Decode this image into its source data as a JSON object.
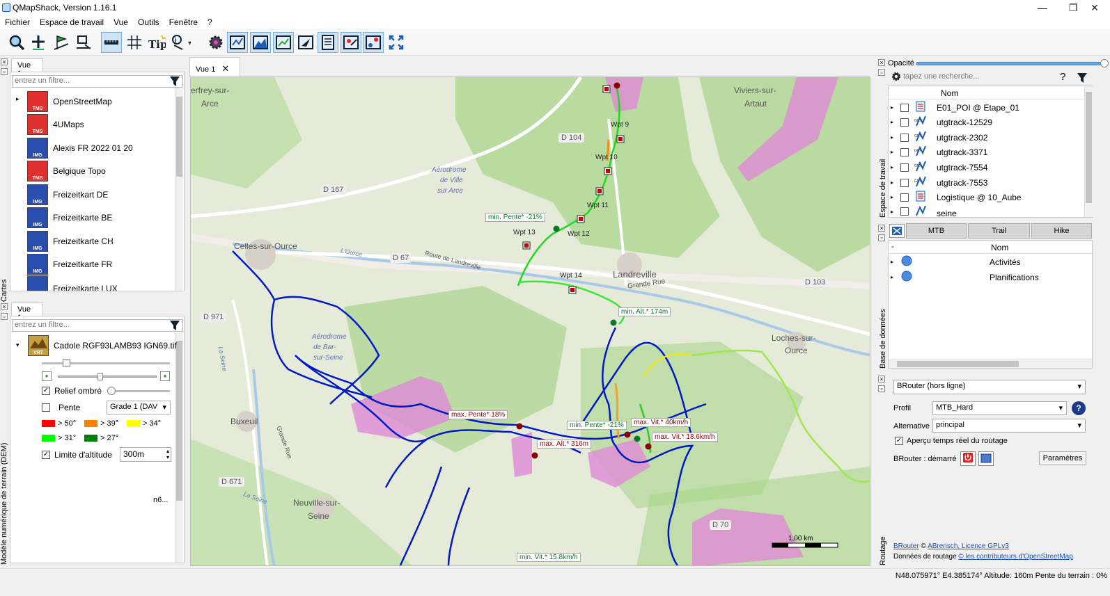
{
  "window": {
    "title": "QMapShack, Version 1.16.1"
  },
  "menu": [
    "Fichier",
    "Espace de travail",
    "Vue",
    "Outils",
    "Fenêtre",
    "?"
  ],
  "maps_panel": {
    "side_label": "Cartes",
    "tab": "Vue 1",
    "filter_placeholder": "entrez un filtre...",
    "items": [
      {
        "name": "OpenStreetMap",
        "type": "TMS"
      },
      {
        "name": "4UMaps",
        "type": "TMS"
      },
      {
        "name": "Alexis FR 2022 01 20",
        "type": "IMG"
      },
      {
        "name": "Belgique Topo",
        "type": "TMS"
      },
      {
        "name": "Freizeitkart DE",
        "type": "IMG"
      },
      {
        "name": "Freizeitkarte BE",
        "type": "IMG"
      },
      {
        "name": "Freizeitkarte CH",
        "type": "IMG"
      },
      {
        "name": "Freizeitkarte FR",
        "type": "IMG"
      },
      {
        "name": "Freizeitkarte LUX",
        "type": "IMG"
      }
    ]
  },
  "dem_panel": {
    "side_label": "Modèle numérique de terrain (DEM)",
    "tab": "Vue 1",
    "filter_placeholder": "entrez un filtre...",
    "item": {
      "name": "Cadole RGF93LAMB93 IGN69.tif",
      "type": "VRT"
    },
    "hillshade_label": "Relief ombré",
    "slope_label": "Pente",
    "slope_grade": "Grade 1 (DAV",
    "slope_legend": [
      {
        "label": "> 50°",
        "color": "#ff0000"
      },
      {
        "label": "> 39°",
        "color": "#ff8000"
      },
      {
        "label": "> 34°",
        "color": "#ffff00"
      },
      {
        "label": "> 31°",
        "color": "#00ff00"
      },
      {
        "label": "> 27°",
        "color": "#008000"
      }
    ],
    "alt_limit_label": "Limite d'altitude",
    "alt_limit_value": "300m",
    "truncated": "n6..."
  },
  "map_view": {
    "tab": "Vue 1",
    "scale": "1,00 km",
    "places": [
      "erfrey-sur-",
      "Arce",
      "Viviers-sur-",
      "Artaut",
      "Aérodrome",
      "de Ville",
      "sur Arce",
      "Celles-sur-Ource",
      "Route de Landreville",
      "L'Ource",
      "Landreville",
      "Grande Rue",
      "Loches-sur-",
      "Ource",
      "Aérodrome",
      "de Bar-",
      "sur-Seine",
      "Buxeuil",
      "Grande Rue",
      "Neuville-sur-",
      "Seine",
      "La Seine",
      "La Seine"
    ],
    "roads": [
      "D 104",
      "D 167",
      "D 67",
      "D 103",
      "D 971",
      "D 671",
      "D 70"
    ],
    "waypoints": [
      "Wpt 9",
      "Wpt 10",
      "Wpt 11",
      "Wpt 12",
      "Wpt 13",
      "Wpt 14"
    ],
    "annotations": {
      "min_slope_1": "min. Pente* -21%",
      "min_alt": "min. Alt.* 174m",
      "max_slope": "max. Pente* 18%",
      "min_slope_2": "min. Pente* -21%",
      "max_speed_1": "max. Vit.* 40km/h",
      "max_speed_2": "max. Vit.* 18.6km/h",
      "max_alt": "max. Alt.* 316m",
      "min_speed": "min. Vit.* 15.8km/h"
    }
  },
  "workspace": {
    "side_label": "Espace de travail",
    "opacity_label": "Opacité",
    "search_placeholder": "tapez une recherche...",
    "col_name": "Nom",
    "items": [
      "E01_POI @ Etape_01",
      "utgtrack-12529",
      "utgtrack-2302",
      "utgtrack-3371",
      "utgtrack-7554",
      "utgtrack-7553",
      "Logistique @ 10_Aube",
      "seine"
    ]
  },
  "database": {
    "side_label": "Base de données",
    "tabs": [
      "MTB",
      "Trail",
      "Hike"
    ],
    "col_dash": "-",
    "col_name": "Nom",
    "items": [
      "Activités",
      "Planifications"
    ]
  },
  "routing": {
    "side_label": "Routage",
    "engine": "BRouter (hors ligne)",
    "profile_label": "Profil",
    "profile_value": "MTB_Hard",
    "alt_label": "Alternative",
    "alt_value": "principal",
    "preview_label": "Aperçu temps réel du routage",
    "brouter_label": "BRouter :  démarré",
    "params_button": "Paramètres",
    "credit1_link1": "BRouter",
    "credit1_sep": " © ",
    "credit1_link2": "ABrensch, Licence GPLv3",
    "credit2_text": "Données de routage ",
    "credit2_link": "© les contributeurs d'OpenStreetMap"
  },
  "status": {
    "text": "N48.075971° E4.385174°  Altitude: 160m  Pente du terrain : 0%"
  }
}
